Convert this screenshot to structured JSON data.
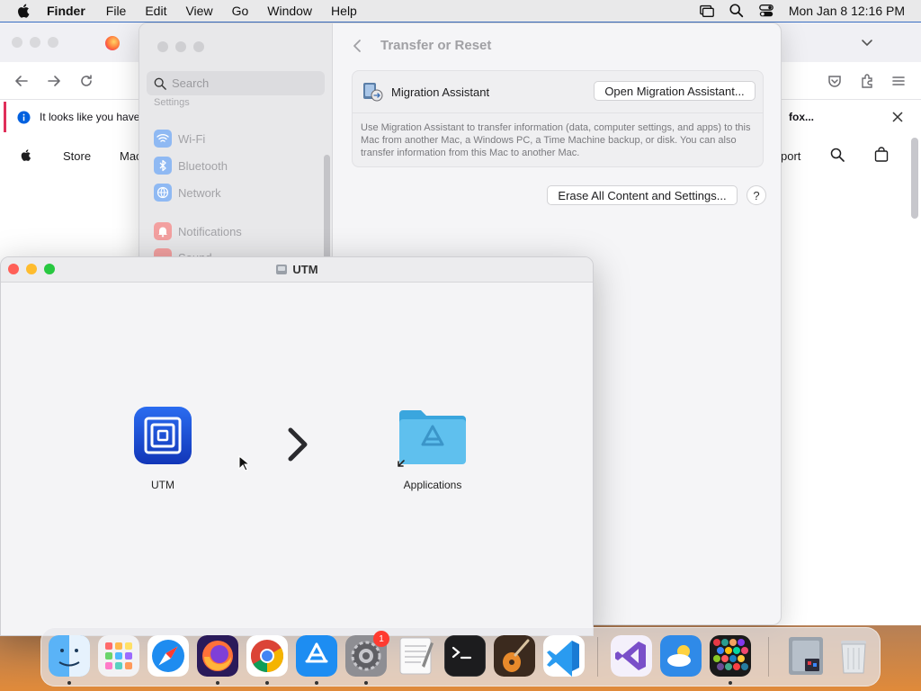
{
  "menubar": {
    "app_name": "Finder",
    "items": [
      "File",
      "Edit",
      "View",
      "Go",
      "Window",
      "Help"
    ],
    "clock": "Mon Jan 8  12:16 PM"
  },
  "browser": {
    "notice_text": "It looks like you haven",
    "notice_link": "fox...",
    "site_nav": {
      "store": "Store",
      "mac": "Mac",
      "support": "port"
    }
  },
  "settings": {
    "search_placeholder": "Search",
    "section_label": "Settings",
    "sidebar_items": [
      {
        "label": "Wi-Fi",
        "icon": "wifi-icon",
        "color": "#3b8cf5"
      },
      {
        "label": "Bluetooth",
        "icon": "bluetooth-icon",
        "color": "#3b8cf5"
      },
      {
        "label": "Network",
        "icon": "network-icon",
        "color": "#3b8cf5"
      },
      {
        "label": "Notifications",
        "icon": "bell-icon",
        "color": "#f55b5b"
      },
      {
        "label": "Sound",
        "icon": "sound-icon",
        "color": "#f55b5b"
      }
    ],
    "header_title": "Transfer or Reset",
    "migration": {
      "title": "Migration Assistant",
      "button": "Open Migration Assistant...",
      "description": "Use Migration Assistant to transfer information (data, computer settings, and apps) to this Mac from another Mac, a Windows PC, a Time Machine backup, or disk. You can also transfer information from this Mac to another Mac."
    },
    "erase_button": "Erase All Content and Settings...",
    "help_button": "?"
  },
  "utm_window": {
    "title": "UTM",
    "app_label": "UTM",
    "folder_label": "Applications"
  },
  "dock": {
    "badge_count": "1",
    "apps": [
      "finder-icon",
      "launchpad-icon",
      "safari-icon",
      "firefox-icon",
      "chrome-icon",
      "app-store-icon",
      "system-settings-icon",
      "textedit-icon",
      "terminal-icon",
      "garageband-icon",
      "vscode-icon",
      "visual-studio-icon",
      "weather-icon",
      "game-icon",
      "downloads-stack-icon",
      "trash-icon"
    ]
  }
}
